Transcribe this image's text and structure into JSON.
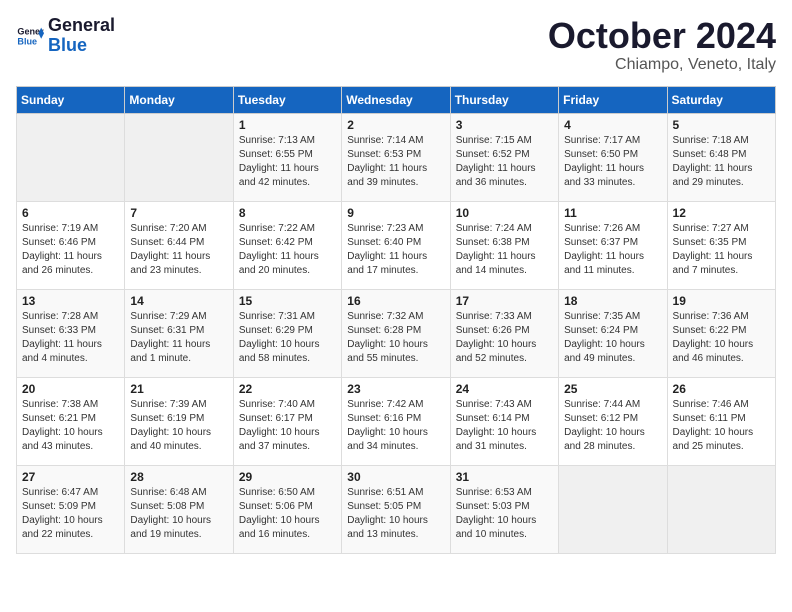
{
  "header": {
    "logo_text_general": "General",
    "logo_text_blue": "Blue",
    "month": "October 2024",
    "location": "Chiampo, Veneto, Italy"
  },
  "weekdays": [
    "Sunday",
    "Monday",
    "Tuesday",
    "Wednesday",
    "Thursday",
    "Friday",
    "Saturday"
  ],
  "weeks": [
    [
      null,
      null,
      {
        "day": "1",
        "sunrise": "Sunrise: 7:13 AM",
        "sunset": "Sunset: 6:55 PM",
        "daylight": "Daylight: 11 hours and 42 minutes."
      },
      {
        "day": "2",
        "sunrise": "Sunrise: 7:14 AM",
        "sunset": "Sunset: 6:53 PM",
        "daylight": "Daylight: 11 hours and 39 minutes."
      },
      {
        "day": "3",
        "sunrise": "Sunrise: 7:15 AM",
        "sunset": "Sunset: 6:52 PM",
        "daylight": "Daylight: 11 hours and 36 minutes."
      },
      {
        "day": "4",
        "sunrise": "Sunrise: 7:17 AM",
        "sunset": "Sunset: 6:50 PM",
        "daylight": "Daylight: 11 hours and 33 minutes."
      },
      {
        "day": "5",
        "sunrise": "Sunrise: 7:18 AM",
        "sunset": "Sunset: 6:48 PM",
        "daylight": "Daylight: 11 hours and 29 minutes."
      }
    ],
    [
      {
        "day": "6",
        "sunrise": "Sunrise: 7:19 AM",
        "sunset": "Sunset: 6:46 PM",
        "daylight": "Daylight: 11 hours and 26 minutes."
      },
      {
        "day": "7",
        "sunrise": "Sunrise: 7:20 AM",
        "sunset": "Sunset: 6:44 PM",
        "daylight": "Daylight: 11 hours and 23 minutes."
      },
      {
        "day": "8",
        "sunrise": "Sunrise: 7:22 AM",
        "sunset": "Sunset: 6:42 PM",
        "daylight": "Daylight: 11 hours and 20 minutes."
      },
      {
        "day": "9",
        "sunrise": "Sunrise: 7:23 AM",
        "sunset": "Sunset: 6:40 PM",
        "daylight": "Daylight: 11 hours and 17 minutes."
      },
      {
        "day": "10",
        "sunrise": "Sunrise: 7:24 AM",
        "sunset": "Sunset: 6:38 PM",
        "daylight": "Daylight: 11 hours and 14 minutes."
      },
      {
        "day": "11",
        "sunrise": "Sunrise: 7:26 AM",
        "sunset": "Sunset: 6:37 PM",
        "daylight": "Daylight: 11 hours and 11 minutes."
      },
      {
        "day": "12",
        "sunrise": "Sunrise: 7:27 AM",
        "sunset": "Sunset: 6:35 PM",
        "daylight": "Daylight: 11 hours and 7 minutes."
      }
    ],
    [
      {
        "day": "13",
        "sunrise": "Sunrise: 7:28 AM",
        "sunset": "Sunset: 6:33 PM",
        "daylight": "Daylight: 11 hours and 4 minutes."
      },
      {
        "day": "14",
        "sunrise": "Sunrise: 7:29 AM",
        "sunset": "Sunset: 6:31 PM",
        "daylight": "Daylight: 11 hours and 1 minute."
      },
      {
        "day": "15",
        "sunrise": "Sunrise: 7:31 AM",
        "sunset": "Sunset: 6:29 PM",
        "daylight": "Daylight: 10 hours and 58 minutes."
      },
      {
        "day": "16",
        "sunrise": "Sunrise: 7:32 AM",
        "sunset": "Sunset: 6:28 PM",
        "daylight": "Daylight: 10 hours and 55 minutes."
      },
      {
        "day": "17",
        "sunrise": "Sunrise: 7:33 AM",
        "sunset": "Sunset: 6:26 PM",
        "daylight": "Daylight: 10 hours and 52 minutes."
      },
      {
        "day": "18",
        "sunrise": "Sunrise: 7:35 AM",
        "sunset": "Sunset: 6:24 PM",
        "daylight": "Daylight: 10 hours and 49 minutes."
      },
      {
        "day": "19",
        "sunrise": "Sunrise: 7:36 AM",
        "sunset": "Sunset: 6:22 PM",
        "daylight": "Daylight: 10 hours and 46 minutes."
      }
    ],
    [
      {
        "day": "20",
        "sunrise": "Sunrise: 7:38 AM",
        "sunset": "Sunset: 6:21 PM",
        "daylight": "Daylight: 10 hours and 43 minutes."
      },
      {
        "day": "21",
        "sunrise": "Sunrise: 7:39 AM",
        "sunset": "Sunset: 6:19 PM",
        "daylight": "Daylight: 10 hours and 40 minutes."
      },
      {
        "day": "22",
        "sunrise": "Sunrise: 7:40 AM",
        "sunset": "Sunset: 6:17 PM",
        "daylight": "Daylight: 10 hours and 37 minutes."
      },
      {
        "day": "23",
        "sunrise": "Sunrise: 7:42 AM",
        "sunset": "Sunset: 6:16 PM",
        "daylight": "Daylight: 10 hours and 34 minutes."
      },
      {
        "day": "24",
        "sunrise": "Sunrise: 7:43 AM",
        "sunset": "Sunset: 6:14 PM",
        "daylight": "Daylight: 10 hours and 31 minutes."
      },
      {
        "day": "25",
        "sunrise": "Sunrise: 7:44 AM",
        "sunset": "Sunset: 6:12 PM",
        "daylight": "Daylight: 10 hours and 28 minutes."
      },
      {
        "day": "26",
        "sunrise": "Sunrise: 7:46 AM",
        "sunset": "Sunset: 6:11 PM",
        "daylight": "Daylight: 10 hours and 25 minutes."
      }
    ],
    [
      {
        "day": "27",
        "sunrise": "Sunrise: 6:47 AM",
        "sunset": "Sunset: 5:09 PM",
        "daylight": "Daylight: 10 hours and 22 minutes."
      },
      {
        "day": "28",
        "sunrise": "Sunrise: 6:48 AM",
        "sunset": "Sunset: 5:08 PM",
        "daylight": "Daylight: 10 hours and 19 minutes."
      },
      {
        "day": "29",
        "sunrise": "Sunrise: 6:50 AM",
        "sunset": "Sunset: 5:06 PM",
        "daylight": "Daylight: 10 hours and 16 minutes."
      },
      {
        "day": "30",
        "sunrise": "Sunrise: 6:51 AM",
        "sunset": "Sunset: 5:05 PM",
        "daylight": "Daylight: 10 hours and 13 minutes."
      },
      {
        "day": "31",
        "sunrise": "Sunrise: 6:53 AM",
        "sunset": "Sunset: 5:03 PM",
        "daylight": "Daylight: 10 hours and 10 minutes."
      },
      null,
      null
    ]
  ]
}
